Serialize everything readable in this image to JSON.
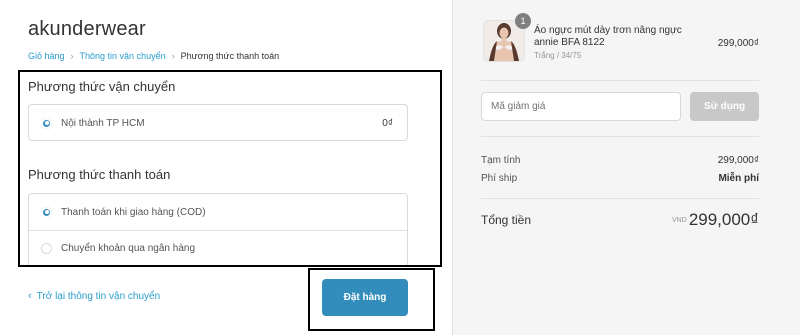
{
  "store": {
    "name": "akunderwear"
  },
  "breadcrumb": {
    "items": [
      "Giỏ hàng",
      "Thông tin vận chuyển"
    ],
    "current": "Phương thức thanh toán",
    "separator": "›"
  },
  "shipping": {
    "title": "Phương thức vận chuyển",
    "option": {
      "label": "Nội thành TP HCM",
      "price": "0₫",
      "selected": true
    }
  },
  "payment": {
    "title": "Phương thức thanh toán",
    "options": [
      {
        "label": "Thanh toán khi giao hàng (COD)",
        "selected": true
      },
      {
        "label": "Chuyển khoản qua ngân hàng",
        "selected": false
      }
    ]
  },
  "footer": {
    "back_label": "Trở lại thông tin vận chuyển",
    "back_icon": "chevron-left-icon",
    "submit_label": "Đặt hàng"
  },
  "cart": {
    "product": {
      "name": "Áo ngực mút dày trơn nâng ngực annie BFA 8122",
      "variant": "Trắng / 34/75",
      "price": "299,000₫",
      "quantity": "1"
    },
    "discount": {
      "placeholder": "Mã giảm giá",
      "apply_label": "Sử dụng"
    },
    "summary": {
      "subtotal_label": "Tạm tính",
      "subtotal_value": "299,000₫",
      "shipping_label": "Phí ship",
      "shipping_value": "Miễn phí"
    },
    "total": {
      "label": "Tổng tiền",
      "currency": "VND",
      "value": "299,000₫"
    }
  },
  "colors": {
    "accent": "#338dbc",
    "link": "#2a9dcc",
    "sidebar_bg": "#f5f5f5",
    "disabled_button": "#c8c8c8"
  }
}
